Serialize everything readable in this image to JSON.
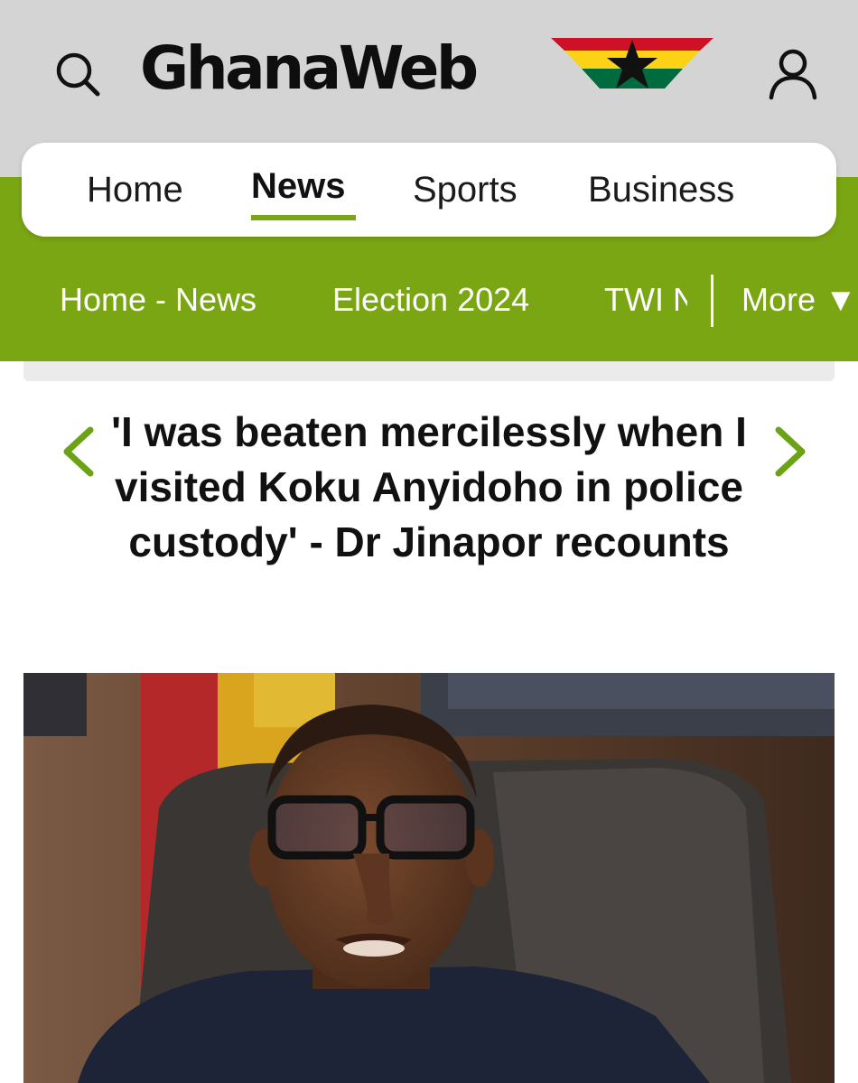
{
  "header": {
    "logo_text": "GhanaWeb",
    "icons": {
      "search": "search-icon",
      "user": "user-icon",
      "flag": "ghana-flag-star-icon"
    }
  },
  "main_nav": {
    "items": [
      {
        "label": "Home",
        "active": false
      },
      {
        "label": "News",
        "active": true
      },
      {
        "label": "Sports",
        "active": false
      },
      {
        "label": "Business",
        "active": false
      }
    ]
  },
  "sub_nav": {
    "items": [
      "Home - News",
      "Election 2024",
      "TWI N"
    ],
    "more_label": "More ▼"
  },
  "article": {
    "headline": "'I was beaten mercilessly when I visited Koku Anyidoho in police custody' - Dr Jinapor recounts",
    "icons": {
      "prev": "chevron-left-icon",
      "next": "chevron-right-icon"
    }
  },
  "colors": {
    "brand_green": "#7aa614",
    "header_grey": "#d4d4d4",
    "text_dark": "#111111",
    "flag_red": "#ce1126",
    "flag_yellow": "#fcd116",
    "flag_green": "#006b3f"
  }
}
